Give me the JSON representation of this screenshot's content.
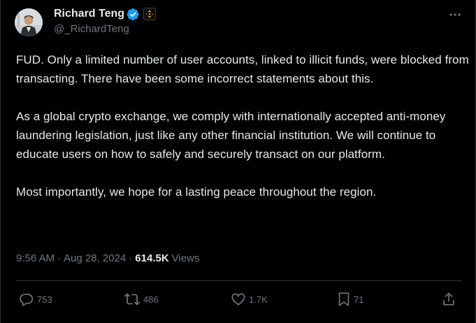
{
  "author": {
    "display_name": "Richard Teng",
    "handle": "@_RichardTeng",
    "verified_icon": "verified-badge-icon",
    "affiliate_icon": "binance-logo-icon"
  },
  "post": {
    "paragraphs": [
      "FUD. Only a limited number of user accounts, linked to illicit funds, were blocked from transacting. There have been some incorrect statements about this.",
      "As a global crypto exchange, we comply with internationally accepted anti-money laundering legislation, just like any other financial institution. We will continue to educate users on how to safely and securely transact on our platform.",
      "Most importantly, we hope for a lasting peace throughout the region."
    ],
    "time": "9:56 AM",
    "date": "Aug 28, 2024",
    "separator": "·",
    "views_count": "614.5K",
    "views_label": "Views"
  },
  "actions": {
    "replies": "753",
    "reposts": "486",
    "likes": "1.7K",
    "bookmarks": "71"
  },
  "colors": {
    "background": "#000000",
    "text_primary": "#e7e9ea",
    "text_secondary": "#71767b",
    "verified_blue": "#1d9bf0",
    "binance_yellow": "#f0b90b",
    "divider": "#2f3336"
  }
}
